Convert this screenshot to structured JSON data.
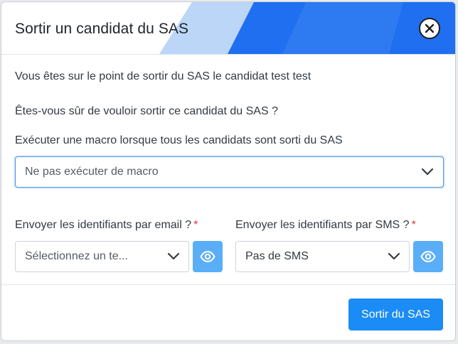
{
  "modal": {
    "title": "Sortir un candidat du SAS",
    "close_icon": "close-circle-icon"
  },
  "body": {
    "info_text": "Vous êtes sur le point de sortir du SAS le candidat test test",
    "confirm_text": "Êtes-vous sûr de vouloir sortir ce candidat du SAS ?"
  },
  "macro": {
    "label": "Exécuter une macro lorsque tous les candidats sont sorti du SAS",
    "selected": "Ne pas exécuter de macro"
  },
  "email": {
    "label": "Envoyer les identifiants par email ?",
    "required_mark": "*",
    "selected": "Sélectionnez un te...",
    "preview_icon": "eye-icon"
  },
  "sms": {
    "label": "Envoyer les identifiants par SMS ?",
    "required_mark": "*",
    "selected": "Pas de SMS",
    "preview_icon": "eye-icon"
  },
  "footer": {
    "submit_label": "Sortir du SAS"
  },
  "colors": {
    "primary": "#1b8cf5",
    "eye_button": "#5aaef7",
    "header_accent": "#1f6ff0",
    "required": "#dc3545"
  }
}
